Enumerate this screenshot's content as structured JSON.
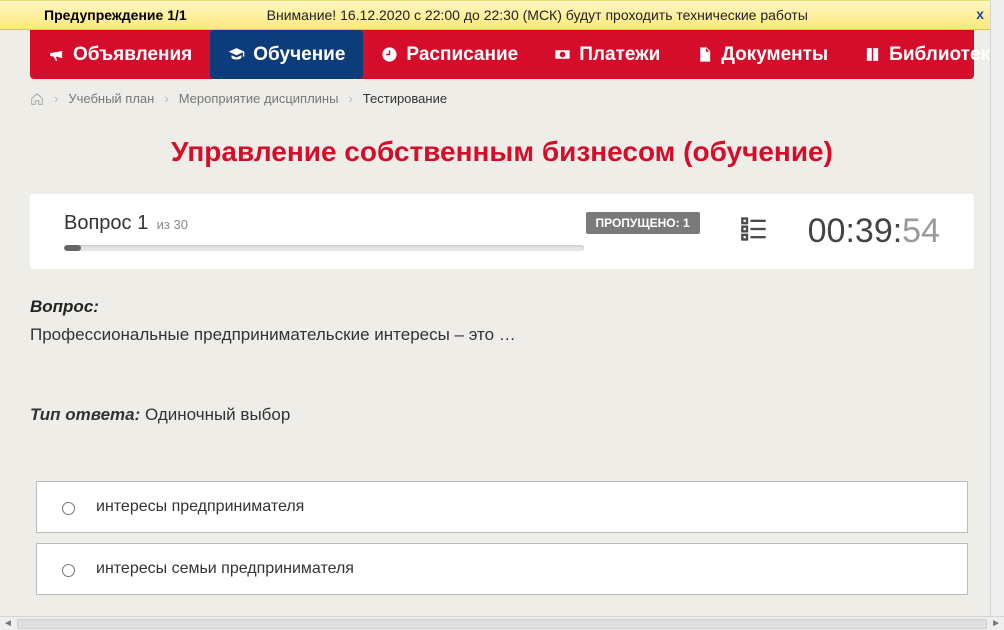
{
  "warning": {
    "title": "Предупреждение 1/1",
    "message": "Внимание! 16.12.2020 с 22:00 до 22:30 (МСК) будут проходить технические работы",
    "close": "x"
  },
  "nav": [
    {
      "label": "Объявления",
      "active": false
    },
    {
      "label": "Обучение",
      "active": true
    },
    {
      "label": "Расписание",
      "active": false
    },
    {
      "label": "Платежи",
      "active": false
    },
    {
      "label": "Документы",
      "active": false
    },
    {
      "label": "Библиотека",
      "active": false,
      "dropdown": true
    }
  ],
  "breadcrumb": {
    "items": [
      "Учебный план",
      "Мероприятие дисциплины"
    ],
    "current": "Тестирование"
  },
  "page_title": "Управление собственным бизнесом (обучение)",
  "progress": {
    "question_label": "Вопрос 1",
    "total_suffix": "из 30",
    "skipped_label": "ПРОПУЩЕНО: 1",
    "percent": 3.3
  },
  "timer": {
    "hm": "00:39:",
    "sec": "54"
  },
  "question": {
    "header": "Вопрос:",
    "text": "Профессиональные предпринимательские интересы – это …",
    "answer_type_label": "Тип ответа:",
    "answer_type_value": " Одиночный выбор"
  },
  "options": [
    {
      "label": "интересы предпринимателя"
    },
    {
      "label": "интересы семьи предпринимателя"
    }
  ]
}
